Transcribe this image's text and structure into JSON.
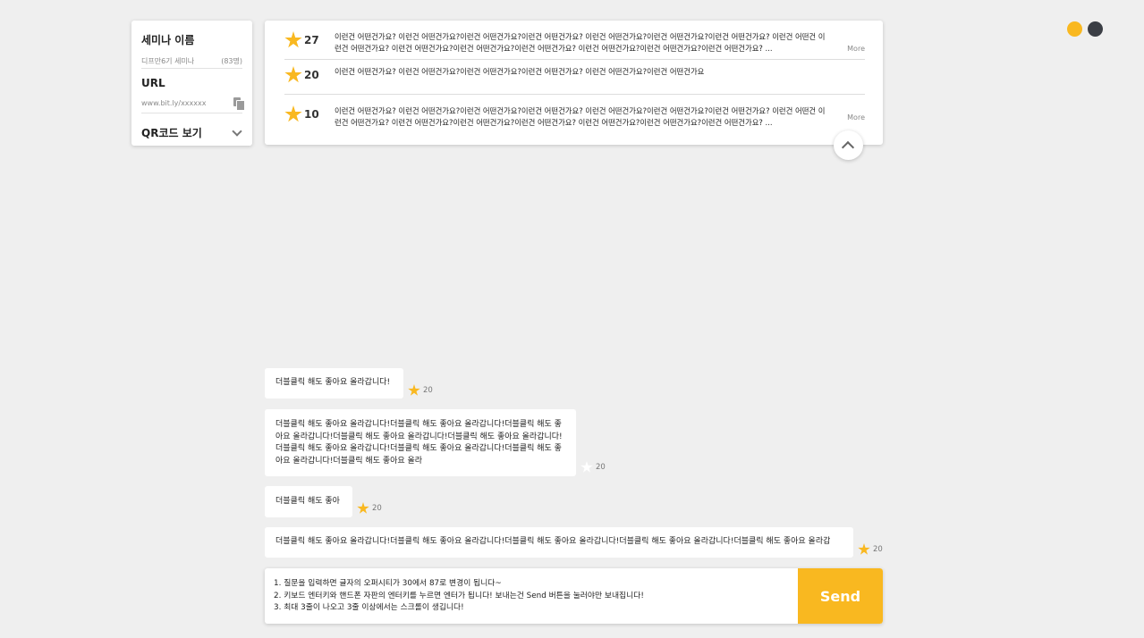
{
  "seminar": {
    "name_label": "세미나 이름",
    "name": "디프만6기 세미나",
    "participants": "(83명)",
    "url_label": "URL",
    "url": "www.bit.ly/xxxxxx",
    "qr_label": "QR코드 보기"
  },
  "top_questions": [
    {
      "stars": "27",
      "text": "이런건 어떤건가요? 이런건 어떤건가요?이런건 어떤건가요?이런건 어떤건가요? 이런건 어떤건가요?이런건 어떤건가요?이런건 어떤건가요? 이런건 어떤건 이런건 어떤건가요? 이런건 어떤건가요?이런건 어떤건가요?이런건 어떤건가요? 이런건 어떤건가요?이런건 어떤건가요?이런건 어떤건가요? ...",
      "more": "More"
    },
    {
      "stars": "20",
      "text": "이런건 어떤건가요? 이런건 어떤건가요?이런건 어떤건가요?이런건 어떤건가요? 이런건 어떤건가요?이런건 어떤건가요"
    },
    {
      "stars": "10",
      "text": "이런건 어떤건가요? 이런건 어떤건가요?이런건 어떤건가요?이런건 어떤건가요? 이런건 어떤건가요?이런건 어떤건가요?이런건 어떤건가요? 이런건 어떤건 이런건 어떤건가요? 이런건 어떤건가요?이런건 어떤건가요?이런건 어떤건가요? 이런건 어떤건가요?이런건 어떤건가요?이런건 어떤건가요? ...",
      "more": "More"
    }
  ],
  "messages": [
    {
      "text": "더블클릭 해도 좋아요 올라갑니다!",
      "stars": "20"
    },
    {
      "text": "더블클릭 해도 좋아요 올라갑니다!더블클릭 해도 좋아요 올라갑니다!더블클릭 해도 좋아요 올라갑니다!더블클릭 해도 좋아요 올라갑니다!더블클릭 해도 좋아요 올라갑니다!더블클릭 해도 좋아요 올라갑니다!더블클릭 해도 좋아요 올라갑니다!더블클릭 해도 좋아요 올라갑니다!더블클릭 해도 좋아요 올라",
      "stars": "20"
    },
    {
      "text": "더블클릭 해도 좋아",
      "stars": "20"
    },
    {
      "text": "더블클릭 해도 좋아요 올라갑니다!더블클릭 해도 좋아요 올라갑니다!더블클릭 해도 좋아요 올라갑니다!더블클릭 해도 좋아요 올라갑니다!더블클릭 해도 좋아요 올라갑",
      "stars": "20"
    }
  ],
  "composer": {
    "value": "1. 질문을 입력하면 글자의 오퍼시티가 30에서 87로 변경이 됩니다~\n2. 키보드 엔터키와 핸드폰 자판의 엔터키를 누르면 엔터가 됩니다! 보내는건 Send 버튼을 눌러야만 보내집니다!\n3. 최대 3줄이 나오고 3줄 이상에서는 스크롤이 생깁니다!",
    "send_label": "Send"
  },
  "colors": {
    "accent": "#f9b820",
    "dark_dot": "#3b3e45",
    "background": "#efefef"
  }
}
